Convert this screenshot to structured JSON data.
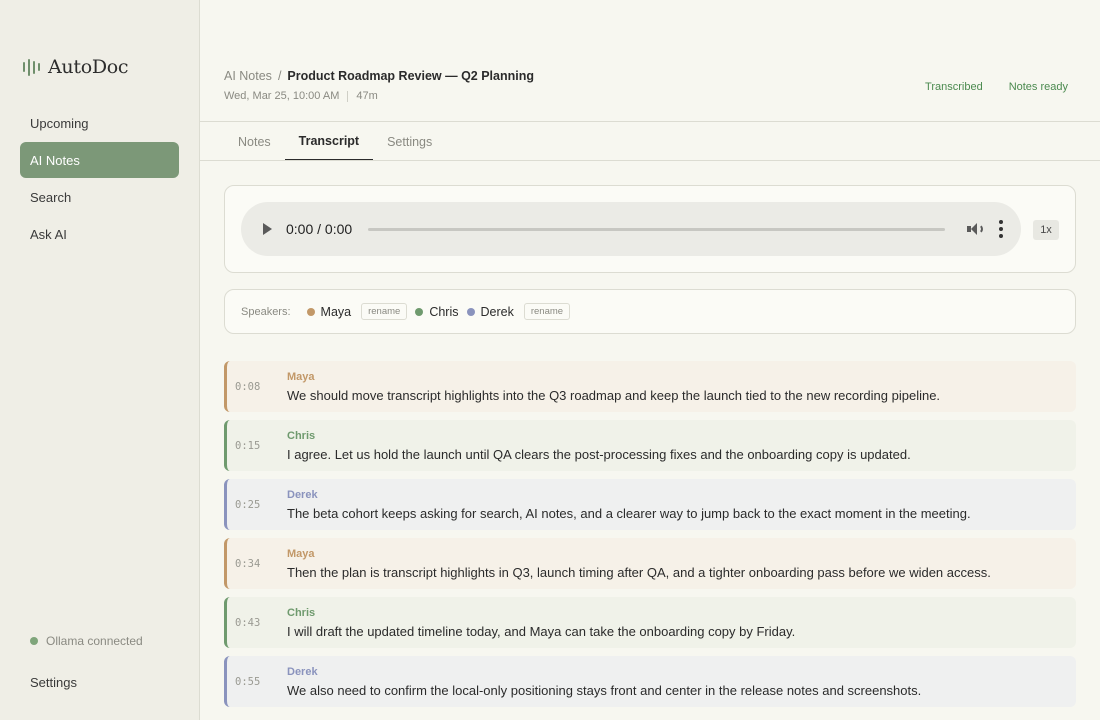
{
  "brand": {
    "name": "AutoDoc"
  },
  "nav": [
    {
      "label": "Upcoming",
      "active": false
    },
    {
      "label": "AI Notes",
      "active": true
    },
    {
      "label": "Search",
      "active": false
    },
    {
      "label": "Ask AI",
      "active": false
    }
  ],
  "status": {
    "ollama": "Ollama connected"
  },
  "sidebar_settings": "Settings",
  "header": {
    "breadcrumb_root": "AI Notes",
    "breadcrumb_sep": "/",
    "title": "Product Roadmap Review — Q2 Planning",
    "date": "Wed, Mar 25, 10:00 AM",
    "duration": "47m",
    "badges": [
      "Transcribed",
      "Notes ready"
    ]
  },
  "tabs": [
    {
      "label": "Notes",
      "active": false
    },
    {
      "label": "Transcript",
      "active": true
    },
    {
      "label": "Settings",
      "active": false
    }
  ],
  "player": {
    "time": "0:00 / 0:00",
    "speed": "1x"
  },
  "speakers": {
    "label": "Speakers:",
    "rename_label": "rename",
    "list": [
      {
        "name": "Maya",
        "color": "#c29868",
        "rename": true
      },
      {
        "name": "Chris",
        "color": "#6f9a6e",
        "rename": false
      },
      {
        "name": "Derek",
        "color": "#8a93bd",
        "rename": true
      }
    ]
  },
  "speaker_styles": {
    "Maya": {
      "color": "#c29868",
      "bg": "#f6f1e8"
    },
    "Chris": {
      "color": "#6f9a6e",
      "bg": "#f0f2e9"
    },
    "Derek": {
      "color": "#8a93bd",
      "bg": "#eff0f0"
    }
  },
  "transcript": [
    {
      "time": "0:08",
      "speaker": "Maya",
      "text": "We should move transcript highlights into the Q3 roadmap and keep the launch tied to the new recording pipeline."
    },
    {
      "time": "0:15",
      "speaker": "Chris",
      "text": "I agree. Let us hold the launch until QA clears the post-processing fixes and the onboarding copy is updated."
    },
    {
      "time": "0:25",
      "speaker": "Derek",
      "text": "The beta cohort keeps asking for search, AI notes, and a clearer way to jump back to the exact moment in the meeting."
    },
    {
      "time": "0:34",
      "speaker": "Maya",
      "text": "Then the plan is transcript highlights in Q3, launch timing after QA, and a tighter onboarding pass before we widen access."
    },
    {
      "time": "0:43",
      "speaker": "Chris",
      "text": "I will draft the updated timeline today, and Maya can take the onboarding copy by Friday."
    },
    {
      "time": "0:55",
      "speaker": "Derek",
      "text": "We also need to confirm the local-only positioning stays front and center in the release notes and screenshots."
    }
  ]
}
